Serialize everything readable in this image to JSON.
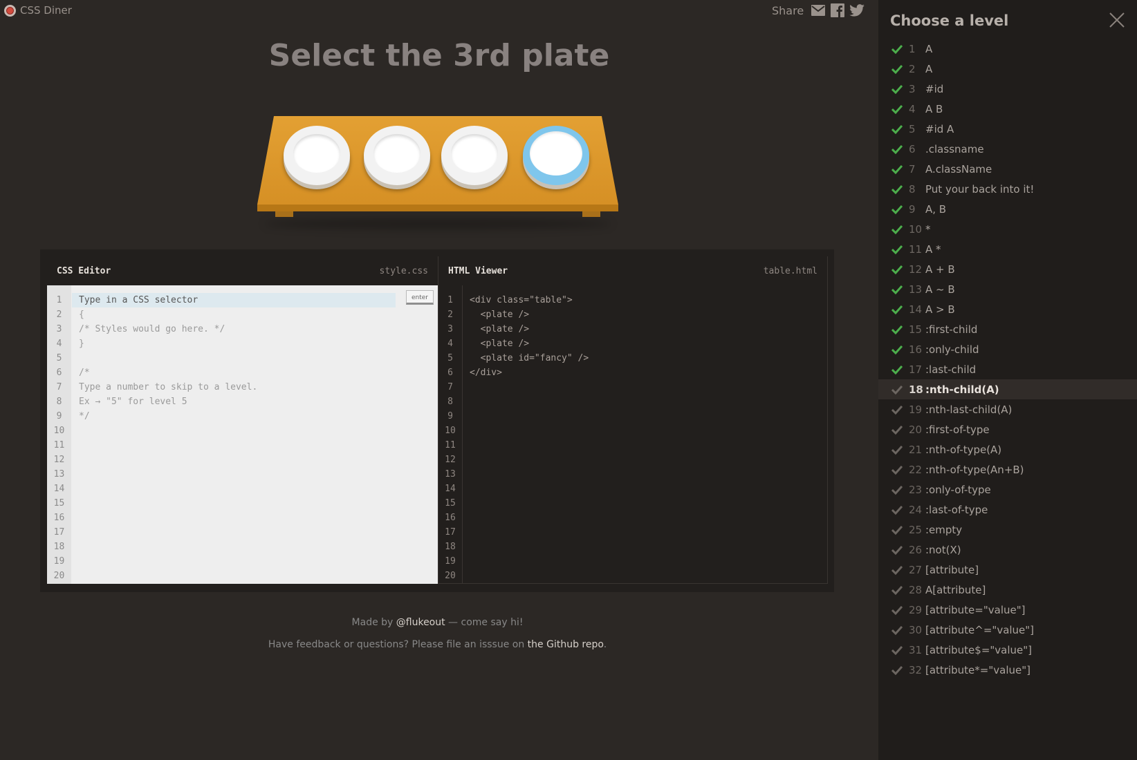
{
  "app": {
    "logo_text": "CSS Diner"
  },
  "share": {
    "label": "Share",
    "icons": [
      "email-icon",
      "facebook-icon",
      "twitter-icon"
    ]
  },
  "instruction": "Select the 3rd plate",
  "table": {
    "plates": [
      "plate",
      "plate",
      "plate",
      "plate#fancy"
    ]
  },
  "css_editor": {
    "title": "CSS Editor",
    "file": "style.css",
    "input_placeholder": "Type in a CSS selector",
    "enter_label": "enter",
    "lines": [
      "",
      "{",
      "/* Styles would go here. */",
      "}",
      "",
      "/*",
      "Type a number to skip to a level.",
      "Ex → \"5\" for level 5",
      "*/",
      "",
      "",
      "",
      "",
      "",
      "",
      "",
      "",
      "",
      "",
      ""
    ],
    "line_numbers": [
      "1",
      "2",
      "3",
      "4",
      "5",
      "6",
      "7",
      "8",
      "9",
      "10",
      "11",
      "12",
      "13",
      "14",
      "15",
      "16",
      "17",
      "18",
      "19",
      "20"
    ]
  },
  "html_viewer": {
    "title": "HTML Viewer",
    "file": "table.html",
    "lines": [
      "<div class=\"table\">",
      "  <plate />",
      "  <plate />",
      "  <plate />",
      "  <plate id=\"fancy\" />",
      "</div>",
      "",
      "",
      "",
      "",
      "",
      "",
      "",
      "",
      "",
      "",
      "",
      "",
      "",
      ""
    ],
    "line_numbers": [
      "1",
      "2",
      "3",
      "4",
      "5",
      "6",
      "7",
      "8",
      "9",
      "10",
      "11",
      "12",
      "13",
      "14",
      "15",
      "16",
      "17",
      "18",
      "19",
      "20"
    ]
  },
  "footer": {
    "made_by_prefix": "Made by ",
    "made_by_link": "@flukeout",
    "made_by_suffix": " — come say hi!",
    "feedback_prefix": "Have feedback or questions? Please file an isssue on ",
    "feedback_link": "the Github repo",
    "feedback_suffix": "."
  },
  "sidebar": {
    "title": "Choose a level",
    "current_level": 18,
    "levels": [
      {
        "num": "1",
        "label": "A",
        "completed": true
      },
      {
        "num": "2",
        "label": "A",
        "completed": true
      },
      {
        "num": "3",
        "label": "#id",
        "completed": true
      },
      {
        "num": "4",
        "label": "A  B",
        "completed": true
      },
      {
        "num": "5",
        "label": "#id  A",
        "completed": true
      },
      {
        "num": "6",
        "label": ".classname",
        "completed": true
      },
      {
        "num": "7",
        "label": "A.className",
        "completed": true
      },
      {
        "num": "8",
        "label": "Put your back into it!",
        "completed": true
      },
      {
        "num": "9",
        "label": "A, B",
        "completed": true
      },
      {
        "num": "10",
        "label": "*",
        "completed": true
      },
      {
        "num": "11",
        "label": "A  *",
        "completed": true
      },
      {
        "num": "12",
        "label": "A + B",
        "completed": true
      },
      {
        "num": "13",
        "label": "A ~ B",
        "completed": true
      },
      {
        "num": "14",
        "label": "A > B",
        "completed": true
      },
      {
        "num": "15",
        "label": ":first-child",
        "completed": true
      },
      {
        "num": "16",
        "label": ":only-child",
        "completed": true
      },
      {
        "num": "17",
        "label": ":last-child",
        "completed": true
      },
      {
        "num": "18",
        "label": ":nth-child(A)",
        "completed": false
      },
      {
        "num": "19",
        "label": ":nth-last-child(A)",
        "completed": false
      },
      {
        "num": "20",
        "label": ":first-of-type",
        "completed": false
      },
      {
        "num": "21",
        "label": ":nth-of-type(A)",
        "completed": false
      },
      {
        "num": "22",
        "label": ":nth-of-type(An+B)",
        "completed": false
      },
      {
        "num": "23",
        "label": ":only-of-type",
        "completed": false
      },
      {
        "num": "24",
        "label": ":last-of-type",
        "completed": false
      },
      {
        "num": "25",
        "label": ":empty",
        "completed": false
      },
      {
        "num": "26",
        "label": ":not(X)",
        "completed": false
      },
      {
        "num": "27",
        "label": "[attribute]",
        "completed": false
      },
      {
        "num": "28",
        "label": "A[attribute]",
        "completed": false
      },
      {
        "num": "29",
        "label": "[attribute=\"value\"]",
        "completed": false
      },
      {
        "num": "30",
        "label": "[attribute^=\"value\"]",
        "completed": false
      },
      {
        "num": "31",
        "label": "[attribute$=\"value\"]",
        "completed": false
      },
      {
        "num": "32",
        "label": "[attribute*=\"value\"]",
        "completed": false
      }
    ]
  },
  "colors": {
    "background": "#2c2825",
    "sidebar": "#201d1b",
    "check_completed": "#4cae4c",
    "check_incomplete": "#6c6661",
    "table": "#e09d30",
    "fancy_plate": "#7fc6ec"
  }
}
